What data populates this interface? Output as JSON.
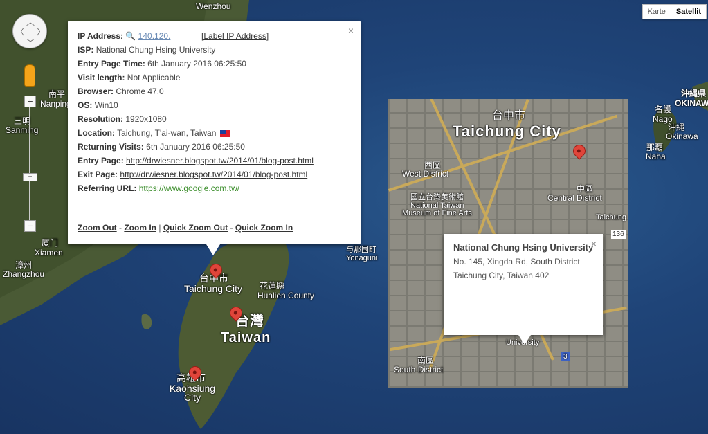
{
  "map_type": {
    "options": [
      "Karte",
      "Satellit"
    ],
    "active": "Satellit"
  },
  "controls": {
    "zoom_in": "+",
    "zoom_out": "−",
    "slider_thumb": "−"
  },
  "labels": {
    "wenzhou": "Wenzhou",
    "nanping_cn": "南平",
    "nanping": "Nanping",
    "sanming_cn": "三明",
    "sanming": "Sanming",
    "xiamen_cn": "厦门",
    "xiamen": "Xiamen",
    "zhangzhou_cn": "漳州",
    "zhangzhou": "Zhangzhou",
    "yonaguni_cn": "与那国町",
    "yonaguni": "Yonaguni",
    "taichung_cn": "台中市",
    "taichung": "Taichung City",
    "hualien_cn": "花蓮縣",
    "hualien": "Hualien County",
    "taiwan_cn": "台灣",
    "taiwan": "Taiwan",
    "kaohsiung_cn": "高雄市",
    "kaohsiung": "Kaohsiung City",
    "okinawa_cn": "沖縄県",
    "okinawa": "OKINAWA",
    "nago_cn": "名護",
    "nago": "Nago",
    "okinawa_city_cn": "沖縄",
    "okinawa_city": "Okinawa",
    "naha_cn": "那覇",
    "naha": "Naha"
  },
  "popup": {
    "ip_label": "IP Address:",
    "ip_value": "140.120.",
    "ip_link": "[Label IP Address]",
    "isp_label": "ISP:",
    "isp_value": "National Chung Hsing University",
    "entry_time_label": "Entry Page Time:",
    "entry_time_value": "6th January 2016 06:25:50",
    "visit_length_label": "Visit length:",
    "visit_length_value": "Not Applicable",
    "browser_label": "Browser:",
    "browser_value": "Chrome 47.0",
    "os_label": "OS:",
    "os_value": "Win10",
    "resolution_label": "Resolution:",
    "resolution_value": "1920x1080",
    "location_label": "Location:",
    "location_value": "Taichung, T'ai-wan, Taiwan",
    "returning_label": "Returning Visits:",
    "returning_value": "6th January 2016 06:25:50",
    "entry_page_label": "Entry Page:",
    "entry_page_value": "http://drwiesner.blogspot.tw/2014/01/blog-post.html",
    "exit_page_label": "Exit Page:",
    "exit_page_value": "http://drwiesner.blogspot.tw/2014/01/blog-post.html",
    "referring_label": "Referring URL:",
    "referring_value": "https://www.google.com.tw/",
    "zoom_out": "Zoom Out",
    "zoom_in": "Zoom In",
    "quick_zoom_out": "Quick Zoom Out",
    "quick_zoom_in": "Quick Zoom In",
    "sep_dash": "-",
    "sep_bar": "|",
    "close": "×"
  },
  "inset": {
    "taichung_cn": "台中市",
    "taichung": "Taichung City",
    "west_cn": "西區",
    "west": "West District",
    "central_cn": "中區",
    "central": "Central District",
    "museum_cn": "國立台灣美術館",
    "museum_en1": "National Taiwan",
    "museum_en2": "Museum of Fine Arts",
    "south_cn": "南區",
    "south": "South District",
    "taichung_station": "Taichung",
    "univ_label": "University",
    "road_sign": "136",
    "road_sign2": "3"
  },
  "inset_popup": {
    "title": "National Chung Hsing University",
    "address_line1": "No. 145, Xingda Rd, South District",
    "address_line2": "Taichung City, Taiwan 402",
    "close": "×"
  }
}
